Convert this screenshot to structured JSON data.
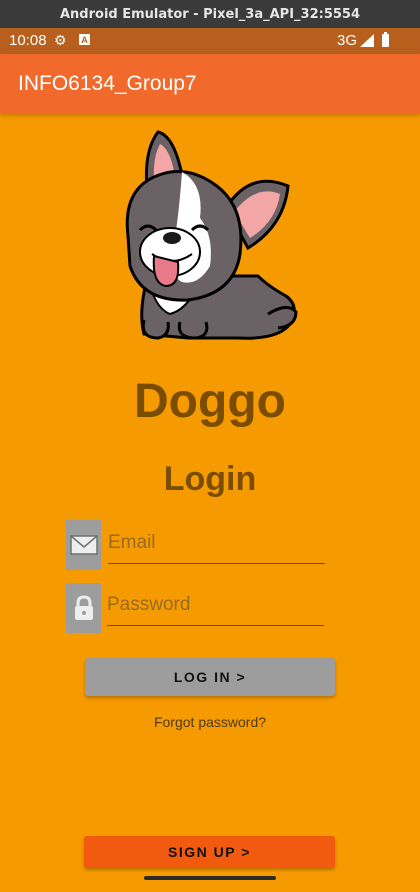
{
  "emulator": {
    "title": "Android Emulator - Pixel_3a_API_32:5554"
  },
  "status_bar": {
    "time": "10:08",
    "network": "3G"
  },
  "app_bar": {
    "title": "INFO6134_Group7"
  },
  "brand": {
    "name": "Doggo"
  },
  "login": {
    "title": "Login",
    "email_placeholder": "Email",
    "password_placeholder": "Password",
    "login_button": "LOG IN >",
    "forgot_password": "Forgot password?",
    "signup_button": "SIGN UP >"
  },
  "colors": {
    "background": "#f59a00",
    "app_bar": "#f16a2c",
    "status_bar": "#b85f1d",
    "brand_text": "#7a4d00",
    "login_button": "#9d9d9d",
    "signup_button": "#f25a0f"
  },
  "icons": {
    "settings": "gear-icon",
    "email": "envelope-icon",
    "password": "lock-icon"
  }
}
